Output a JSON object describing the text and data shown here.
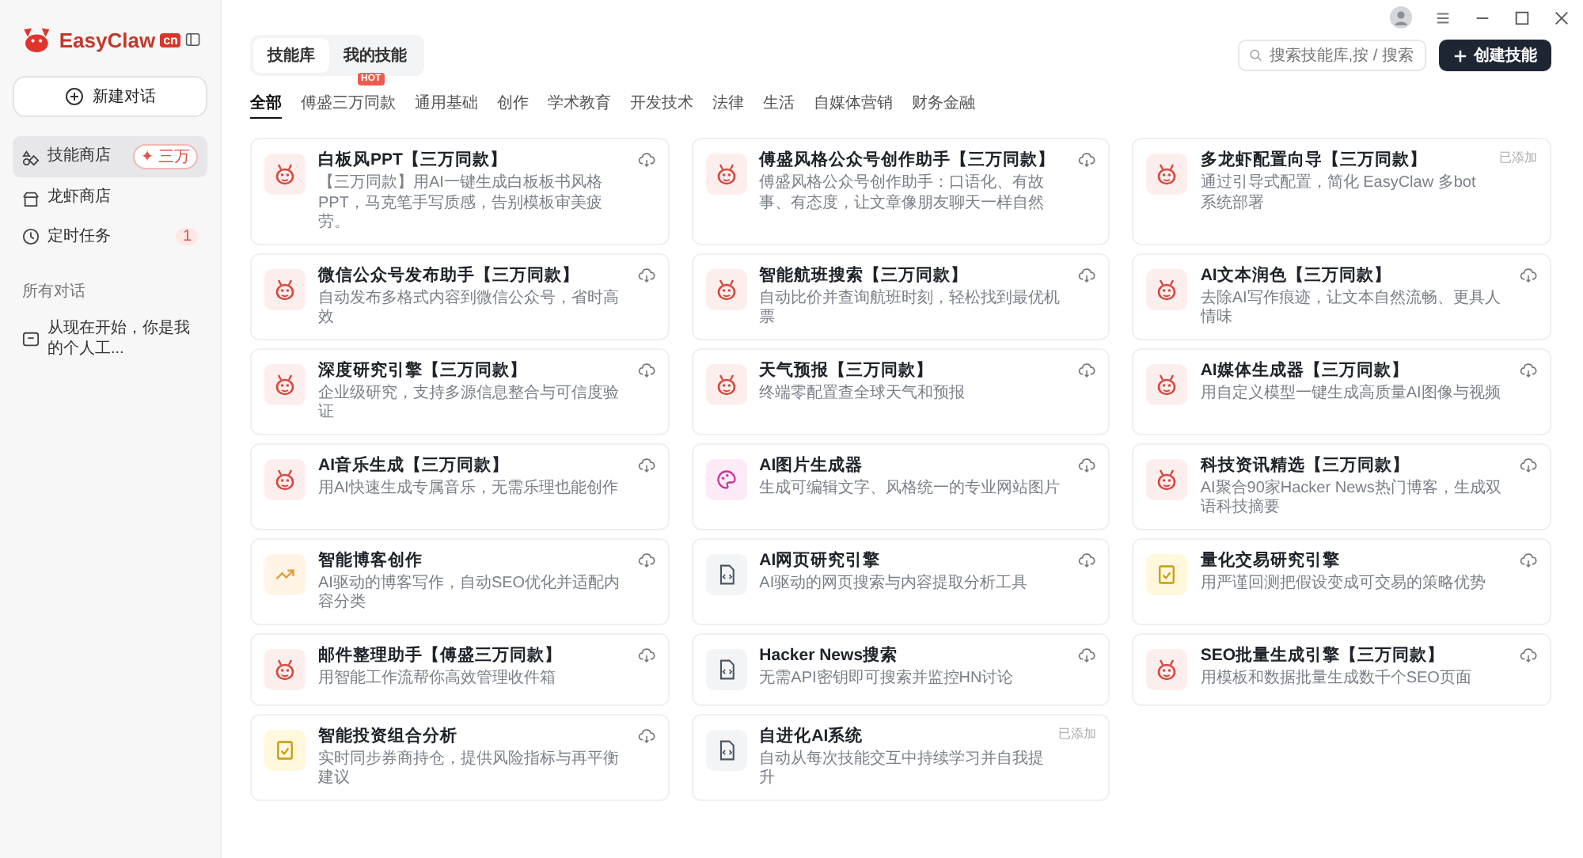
{
  "app": {
    "name": "EasyClaw",
    "region_badge": "cn"
  },
  "sidebar": {
    "new_chat": "新建对话",
    "items": [
      {
        "label": "技能商店",
        "kind": "skills",
        "selected": true,
        "badge": {
          "text": "✦ 三万",
          "kind": "promo"
        }
      },
      {
        "label": "龙虾商店",
        "kind": "store",
        "selected": false
      },
      {
        "label": "定时任务",
        "kind": "clock",
        "selected": false,
        "badge": {
          "text": "1",
          "kind": "count"
        }
      }
    ],
    "section_title": "所有对话",
    "conversations": [
      {
        "label": "从现在开始，你是我的个人工..."
      }
    ]
  },
  "tabs": [
    {
      "label": "技能库",
      "selected": true
    },
    {
      "label": "我的技能",
      "selected": false
    }
  ],
  "search": {
    "placeholder": "搜索技能库,按 / 搜索"
  },
  "create_button": "创建技能",
  "categories": [
    {
      "label": "全部",
      "selected": true
    },
    {
      "label": "傅盛三万同款",
      "selected": false,
      "badge": "HOT"
    },
    {
      "label": "通用基础",
      "selected": false
    },
    {
      "label": "创作",
      "selected": false
    },
    {
      "label": "学术教育",
      "selected": false
    },
    {
      "label": "开发技术",
      "selected": false
    },
    {
      "label": "法律",
      "selected": false
    },
    {
      "label": "生活",
      "selected": false
    },
    {
      "label": "自媒体营销",
      "selected": false
    },
    {
      "label": "财务金融",
      "selected": false
    }
  ],
  "skills": [
    {
      "title": "白板风PPT【三万同款】",
      "description": "【三万同款】用AI一键生成白板板书风格PPT，马克笔手写质感，告别模板审美疲劳。",
      "kind": "lobster",
      "added": false
    },
    {
      "title": "傅盛风格公众号创作助手【三万同款】",
      "description": "傅盛风格公众号创作助手：口语化、有故事、有态度，让文章像朋友聊天一样自然",
      "kind": "lobster",
      "added": false
    },
    {
      "title": "多龙虾配置向导【三万同款】",
      "description": "通过引导式配置，简化 EasyClaw 多bot系统部署",
      "kind": "lobster",
      "added": true,
      "status": "已添加"
    },
    {
      "title": "微信公众号发布助手【三万同款】",
      "description": "自动发布多格式内容到微信公众号，省时高效",
      "kind": "lobster",
      "added": false
    },
    {
      "title": "智能航班搜索【三万同款】",
      "description": "自动比价并查询航班时刻，轻松找到最优机票",
      "kind": "lobster",
      "added": false
    },
    {
      "title": "AI文本润色【三万同款】",
      "description": "去除AI写作痕迹，让文本自然流畅、更具人情味",
      "kind": "lobster",
      "added": false
    },
    {
      "title": "深度研究引擎【三万同款】",
      "description": "企业级研究，支持多源信息整合与可信度验证",
      "kind": "lobster",
      "added": false
    },
    {
      "title": "天气预报【三万同款】",
      "description": "终端零配置查全球天气和预报",
      "kind": "lobster",
      "added": false
    },
    {
      "title": "AI媒体生成器【三万同款】",
      "description": "用自定义模型一键生成高质量AI图像与视频",
      "kind": "lobster",
      "added": false
    },
    {
      "title": "AI音乐生成【三万同款】",
      "description": "用AI快速生成专属音乐，无需乐理也能创作",
      "kind": "lobster",
      "added": false
    },
    {
      "title": "AI图片生成器",
      "description": "生成可编辑文字、风格统一的专业网站图片",
      "kind": "palette",
      "added": false
    },
    {
      "title": "科技资讯精选【三万同款】",
      "description": "AI聚合90家Hacker News热门博客，生成双语科技摘要",
      "kind": "lobster",
      "added": false
    },
    {
      "title": "智能博客创作",
      "description": "AI驱动的博客写作，自动SEO优化并适配内容分类",
      "kind": "trend",
      "added": false
    },
    {
      "title": "AI网页研究引擎",
      "description": "AI驱动的网页搜索与内容提取分析工具",
      "kind": "code",
      "added": false
    },
    {
      "title": "量化交易研究引擎",
      "description": "用严谨回测把假设变成可交易的策略优势",
      "kind": "check",
      "added": false
    },
    {
      "title": "邮件整理助手【傅盛三万同款】",
      "description": "用智能工作流帮你高效管理收件箱",
      "kind": "lobster",
      "added": false
    },
    {
      "title": "Hacker News搜索",
      "description": "无需API密钥即可搜索并监控HN讨论",
      "kind": "code",
      "added": false
    },
    {
      "title": "SEO批量生成引擎【三万同款】",
      "description": "用模板和数据批量生成数千个SEO页面",
      "kind": "lobster",
      "added": false
    },
    {
      "title": "智能投资组合分析",
      "description": "实时同步券商持仓，提供风险指标与再平衡建议",
      "kind": "check",
      "added": false
    },
    {
      "title": "自进化AI系统",
      "description": "自动从每次技能交互中持续学习并自我提升",
      "kind": "code",
      "added": true,
      "status": "已添加"
    }
  ]
}
